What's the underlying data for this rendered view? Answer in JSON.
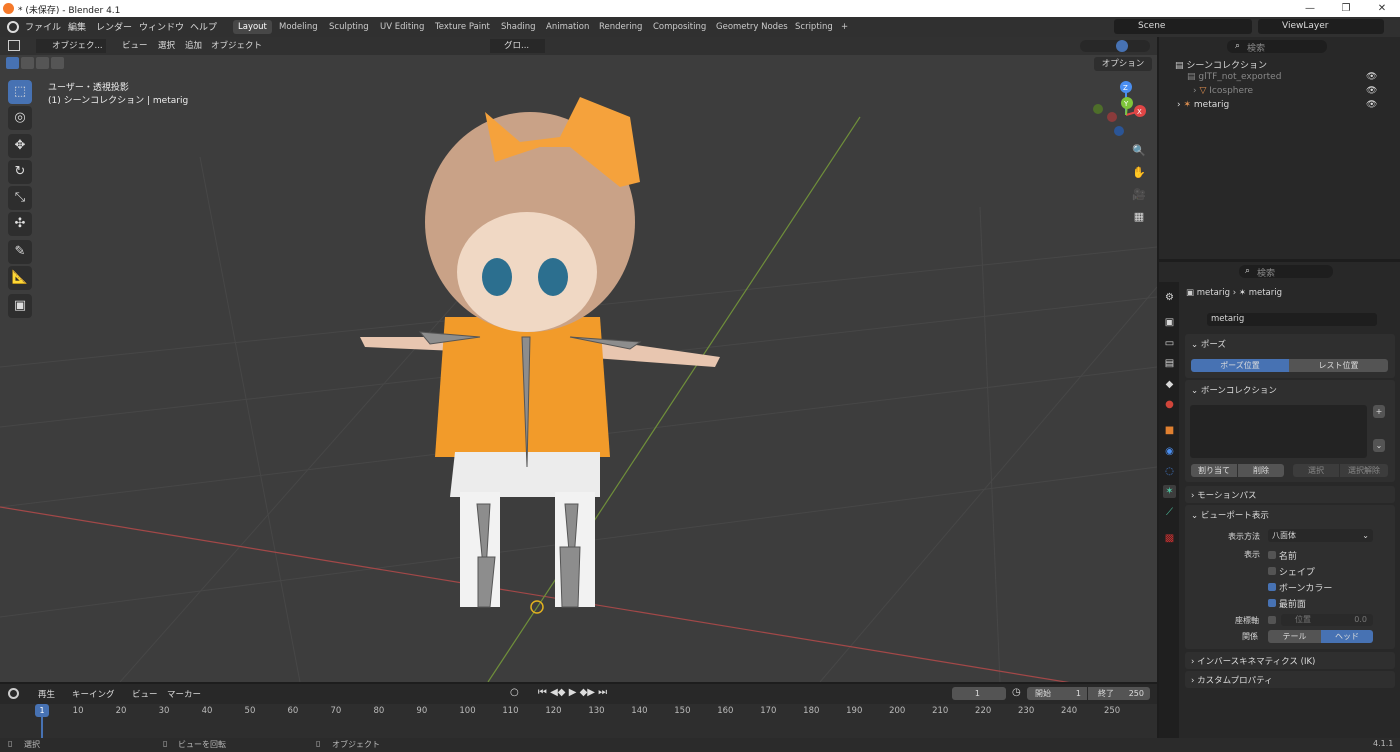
{
  "window": {
    "title": "* (未保存) - Blender 4.1",
    "controls": [
      "—",
      "❐",
      "✕"
    ]
  },
  "menu": [
    "ファイル",
    "編集",
    "レンダー",
    "ウィンドウ",
    "ヘルプ"
  ],
  "workspaces": [
    "Layout",
    "Modeling",
    "Sculpting",
    "UV Editing",
    "Texture Paint",
    "Shading",
    "Animation",
    "Rendering",
    "Compositing",
    "Geometry Nodes",
    "Scripting",
    "+"
  ],
  "scene": {
    "label": "Scene",
    "viewlayer": "ViewLayer"
  },
  "viewport": {
    "mode": "オブジェク...",
    "menus": [
      "ビュー",
      "選択",
      "追加",
      "オブジェクト"
    ],
    "transform": "グロ...",
    "options": "オプション",
    "overlay_line1": "ユーザー・透視投影",
    "overlay_line2": "(1) シーンコレクション | metarig",
    "axes": [
      "X",
      "Y",
      "Z"
    ],
    "accent": "#4772b3"
  },
  "tools": [
    "select-box-icon",
    "cursor-icon",
    "move-icon",
    "rotate-icon",
    "scale-icon",
    "transform-icon",
    "annotate-icon",
    "measure-icon",
    "add-cube-icon"
  ],
  "outliner": {
    "search_placeholder": "検索",
    "root": "シーンコレクション",
    "items": [
      {
        "label": "glTF_not_exported"
      },
      {
        "label": "Icosphere"
      },
      {
        "label": "metarig"
      }
    ]
  },
  "properties": {
    "search_placeholder": "検索",
    "breadcrumb": [
      "metarig",
      "metarig"
    ],
    "data_name": "metarig",
    "pose_section": "ポーズ",
    "pose_position": "ポーズ位置",
    "rest_position": "レスト位置",
    "bone_collections": "ボーンコレクション",
    "bc_buttons": [
      "割り当て",
      "削除",
      "選択",
      "選択解除"
    ],
    "motion_paths": "モーションパス",
    "viewport_display": "ビューポート表示",
    "display_as_label": "表示方法",
    "display_as": "八面体",
    "show_label": "表示",
    "checks": [
      {
        "label": "名前",
        "on": false
      },
      {
        "label": "シェイプ",
        "on": false
      },
      {
        "label": "ボーンカラー",
        "on": true
      },
      {
        "label": "最前面",
        "on": true
      }
    ],
    "axes_label": "座標軸",
    "axes_position": "位置",
    "axes_value": "0.0",
    "relations_label": "関係",
    "relations": [
      "テール",
      "ヘッド"
    ],
    "ik": "インバースキネマティクス (IK)",
    "custom_props": "カスタムプロパティ"
  },
  "timeline": {
    "menus": [
      "再生",
      "キーイング",
      "ビュー",
      "マーカー"
    ],
    "current_frame": "1",
    "start_label": "開始",
    "start": "1",
    "end_label": "終了",
    "end": "250",
    "ticks": [
      "1",
      "10",
      "20",
      "30",
      "40",
      "50",
      "60",
      "70",
      "80",
      "90",
      "100",
      "110",
      "120",
      "130",
      "140",
      "150",
      "160",
      "170",
      "180",
      "190",
      "200",
      "210",
      "220",
      "230",
      "240",
      "250"
    ]
  },
  "status": {
    "items": [
      "選択",
      "ビューを回転",
      "オブジェクト"
    ],
    "version": "4.1.1"
  }
}
